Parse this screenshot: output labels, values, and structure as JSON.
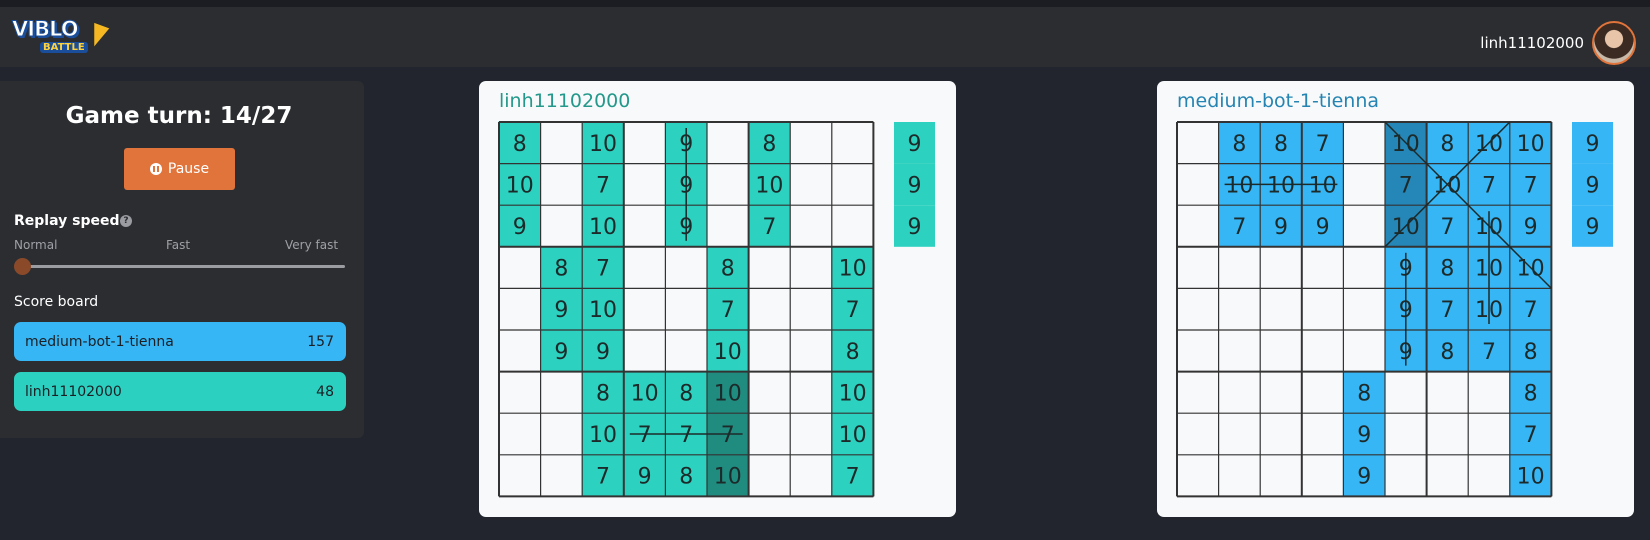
{
  "header": {
    "logo": {
      "top": "VIBLO",
      "bottom": "BATTLE"
    },
    "username": "linh11102000",
    "avatar_icon": "user-avatar"
  },
  "sidebar": {
    "game_turn": "Game turn: 14/27",
    "pause_label": "Pause",
    "replay_speed_label": "Replay speed",
    "help_icon": "question-icon",
    "speed_options": [
      "Normal",
      "Fast",
      "Very fast"
    ],
    "selected_speed": "Normal",
    "score_board_label": "Score board",
    "scores": [
      {
        "name": "medium-bot-1-tienna",
        "score": "157",
        "color": "#36b6f5"
      },
      {
        "name": "linh11102000",
        "score": "48",
        "color": "#2bd0c0"
      }
    ]
  },
  "boards": [
    {
      "player": "linh11102000",
      "fill_color": "#2dd1bf",
      "dark_color": "#208c80",
      "cells": [
        [
          "8",
          "",
          "10",
          "",
          "9",
          "",
          "8",
          "",
          ""
        ],
        [
          "10",
          "",
          "7",
          "",
          "9",
          "",
          "10",
          "",
          ""
        ],
        [
          "9",
          "",
          "10",
          "",
          "9",
          "",
          "7",
          "",
          ""
        ],
        [
          "",
          "8",
          "7",
          "",
          "",
          "8",
          "",
          "",
          "10"
        ],
        [
          "",
          "9",
          "10",
          "",
          "",
          "7",
          "",
          "",
          "7"
        ],
        [
          "",
          "9",
          "9",
          "",
          "",
          "10",
          "",
          "",
          "8"
        ],
        [
          "",
          "",
          "8",
          "10",
          "8",
          "10",
          "",
          "",
          "10"
        ],
        [
          "",
          "",
          "10",
          "7",
          "7",
          "7",
          "",
          "",
          "10"
        ],
        [
          "",
          "",
          "7",
          "9",
          "8",
          "10",
          "",
          "",
          "7"
        ]
      ],
      "filled": [
        [
          1,
          0,
          1,
          0,
          1,
          0,
          1,
          0,
          0
        ],
        [
          1,
          0,
          1,
          0,
          1,
          0,
          1,
          0,
          0
        ],
        [
          1,
          0,
          1,
          0,
          1,
          0,
          1,
          0,
          0
        ],
        [
          0,
          1,
          1,
          0,
          0,
          1,
          0,
          0,
          1
        ],
        [
          0,
          1,
          1,
          0,
          0,
          1,
          0,
          0,
          1
        ],
        [
          0,
          1,
          1,
          0,
          0,
          1,
          0,
          0,
          1
        ],
        [
          0,
          0,
          1,
          1,
          1,
          2,
          0,
          0,
          1
        ],
        [
          0,
          0,
          1,
          1,
          1,
          2,
          0,
          0,
          1
        ],
        [
          0,
          0,
          1,
          1,
          1,
          2,
          0,
          0,
          1
        ]
      ],
      "next_tiles": [
        "9",
        "9",
        "9"
      ],
      "strikes": [
        {
          "type": "vertical",
          "col": 4,
          "from_row": 0,
          "to_row": 2
        },
        {
          "type": "horizontal",
          "row": 7,
          "from_col": 3,
          "to_col": 5
        }
      ]
    },
    {
      "player": "medium-bot-1-tienna",
      "fill_color": "#36b6f5",
      "dark_color": "#2586b8",
      "cells": [
        [
          "",
          "8",
          "8",
          "7",
          "",
          "10",
          "8",
          "10",
          "10"
        ],
        [
          "",
          "10",
          "10",
          "10",
          "",
          "7",
          "10",
          "7",
          "7"
        ],
        [
          "",
          "7",
          "9",
          "9",
          "",
          "10",
          "7",
          "10",
          "9"
        ],
        [
          "",
          "",
          "",
          "",
          "",
          "9",
          "8",
          "10",
          "10"
        ],
        [
          "",
          "",
          "",
          "",
          "",
          "9",
          "7",
          "10",
          "7"
        ],
        [
          "",
          "",
          "",
          "",
          "",
          "9",
          "8",
          "7",
          "8"
        ],
        [
          "",
          "",
          "",
          "",
          "8",
          "",
          "",
          "",
          "8"
        ],
        [
          "",
          "",
          "",
          "",
          "9",
          "",
          "",
          "",
          "7"
        ],
        [
          "",
          "",
          "",
          "",
          "9",
          "",
          "",
          "",
          "10"
        ]
      ],
      "filled": [
        [
          0,
          1,
          1,
          1,
          0,
          2,
          1,
          1,
          1
        ],
        [
          0,
          1,
          1,
          1,
          0,
          2,
          1,
          1,
          1
        ],
        [
          0,
          1,
          1,
          1,
          0,
          2,
          1,
          1,
          1
        ],
        [
          0,
          0,
          0,
          0,
          0,
          1,
          1,
          1,
          1
        ],
        [
          0,
          0,
          0,
          0,
          0,
          1,
          1,
          1,
          1
        ],
        [
          0,
          0,
          0,
          0,
          0,
          1,
          1,
          1,
          1
        ],
        [
          0,
          0,
          0,
          0,
          1,
          0,
          0,
          0,
          1
        ],
        [
          0,
          0,
          0,
          0,
          1,
          0,
          0,
          0,
          1
        ],
        [
          0,
          0,
          0,
          0,
          1,
          0,
          0,
          0,
          1
        ]
      ],
      "next_tiles": [
        "9",
        "9",
        "9"
      ],
      "strikes": [
        {
          "type": "horizontal",
          "row": 1,
          "from_col": 1,
          "to_col": 3
        },
        {
          "type": "vertical",
          "col": 5,
          "from_row": 3,
          "to_row": 5
        },
        {
          "type": "vertical",
          "col": 7,
          "from_row": 2,
          "to_row": 4
        },
        {
          "type": "diagonal",
          "from_row": 0,
          "from_col": 5,
          "to_row": 3,
          "to_col": 8
        },
        {
          "type": "diagonal",
          "from_row": 2,
          "from_col": 5,
          "to_row": 0,
          "to_col": 7
        }
      ]
    }
  ]
}
